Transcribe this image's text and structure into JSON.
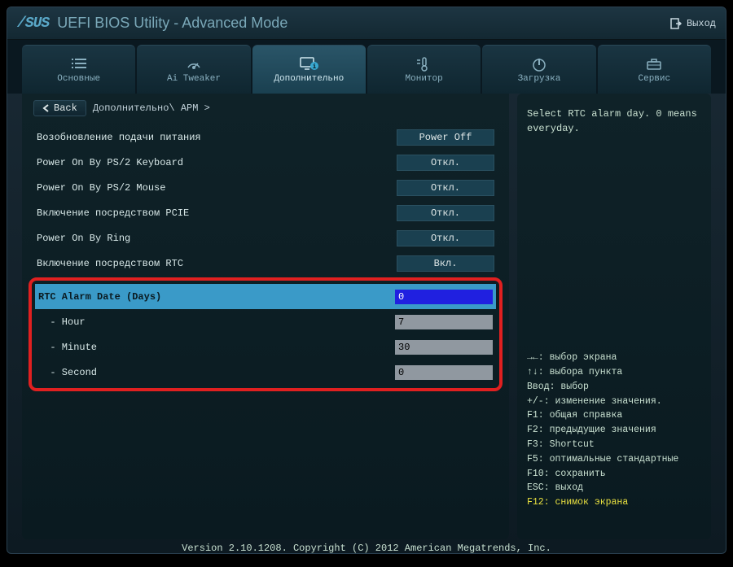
{
  "title": {
    "brand": "/SUS",
    "text": "UEFI BIOS Utility - Advanced Mode"
  },
  "exit": "Выход",
  "tabs": [
    {
      "label": "Основные"
    },
    {
      "label": "Ai Tweaker"
    },
    {
      "label": "Дополнительно"
    },
    {
      "label": "Монитор"
    },
    {
      "label": "Загрузка"
    },
    {
      "label": "Сервис"
    }
  ],
  "back": "Back",
  "breadcrumb": "Дополнительно\\ APM  >",
  "settings": [
    {
      "label": "Возобновление подачи питания",
      "value": "Power Off"
    },
    {
      "label": "Power On By PS/2 Keyboard",
      "value": "Откл."
    },
    {
      "label": "Power On By PS/2 Mouse",
      "value": "Откл."
    },
    {
      "label": "Включение посредством PCIE",
      "value": "Откл."
    },
    {
      "label": "Power On By Ring",
      "value": "Откл."
    },
    {
      "label": "Включение посредством RTC",
      "value": "Вкл."
    }
  ],
  "rtc": {
    "dateLabel": "RTC Alarm Date (Days)",
    "dateValue": "0",
    "hourLabel": "  - Hour",
    "hourValue": "7",
    "minuteLabel": "  - Minute",
    "minuteValue": "30",
    "secondLabel": "  - Second",
    "secondValue": "0"
  },
  "help": "Select RTC alarm day. 0 means everyday.",
  "legend": [
    "→←: выбор экрана",
    "↑↓: выбора пункта",
    "Ввод: выбор",
    "+/-: изменение значения.",
    "F1: общая справка",
    "F2: предыдущие значения",
    "F3: Shortcut",
    "F5: оптимальные стандартные",
    "F10: сохранить",
    "ESC: выход"
  ],
  "legendHighlight": "F12: снимок экрана",
  "footer": "Version 2.10.1208. Copyright (C) 2012 American Megatrends, Inc."
}
